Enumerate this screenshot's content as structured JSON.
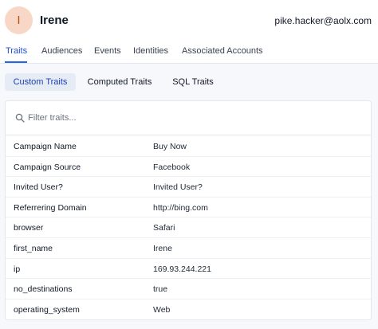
{
  "user": {
    "initial": "I",
    "name": "Irene",
    "email": "pike.hacker@aolx.com"
  },
  "tabs": [
    {
      "label": "Traits",
      "active": true
    },
    {
      "label": "Audiences",
      "active": false
    },
    {
      "label": "Events",
      "active": false
    },
    {
      "label": "Identities",
      "active": false
    },
    {
      "label": "Associated Accounts",
      "active": false
    }
  ],
  "subtabs": [
    {
      "label": "Custom Traits",
      "active": true
    },
    {
      "label": "Computed Traits",
      "active": false
    },
    {
      "label": "SQL Traits",
      "active": false
    }
  ],
  "search": {
    "placeholder": "Filter traits..."
  },
  "traits": [
    {
      "key": "Campaign Name",
      "value": "Buy Now"
    },
    {
      "key": "Campaign Source",
      "value": "Facebook"
    },
    {
      "key": "Invited User?",
      "value": "Invited User?"
    },
    {
      "key": "Referrering Domain",
      "value": "http://bing.com"
    },
    {
      "key": "browser",
      "value": "Safari"
    },
    {
      "key": "first_name",
      "value": "Irene"
    },
    {
      "key": "ip",
      "value": "169.93.244.221"
    },
    {
      "key": "no_destinations",
      "value": "true"
    },
    {
      "key": "operating_system",
      "value": "Web"
    }
  ],
  "colors": {
    "accent": "#2563eb",
    "avatar_bg": "#f9d7c7",
    "page_bg": "#f6f8fb"
  }
}
